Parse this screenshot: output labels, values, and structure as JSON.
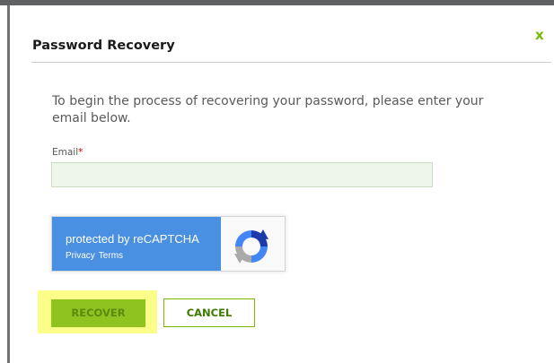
{
  "dialog": {
    "title": "Password Recovery",
    "close_label": "x",
    "intro": "To begin the process of recovering your password, please enter your email below."
  },
  "form": {
    "email_label": "Email",
    "required_marker": "*",
    "email_value": "",
    "email_placeholder": ""
  },
  "recaptcha": {
    "protected_text": "protected by reCAPTCHA",
    "privacy_link": "Privacy",
    "terms_link": "Terms",
    "logo_icon": "recaptcha-logo-icon"
  },
  "buttons": {
    "recover": "RECOVER",
    "cancel": "CANCEL"
  },
  "colors": {
    "accent": "#76b900",
    "recover_button": "#8fc31f",
    "highlight": "#fbff8a",
    "recaptcha_blue": "#4a90e2"
  }
}
